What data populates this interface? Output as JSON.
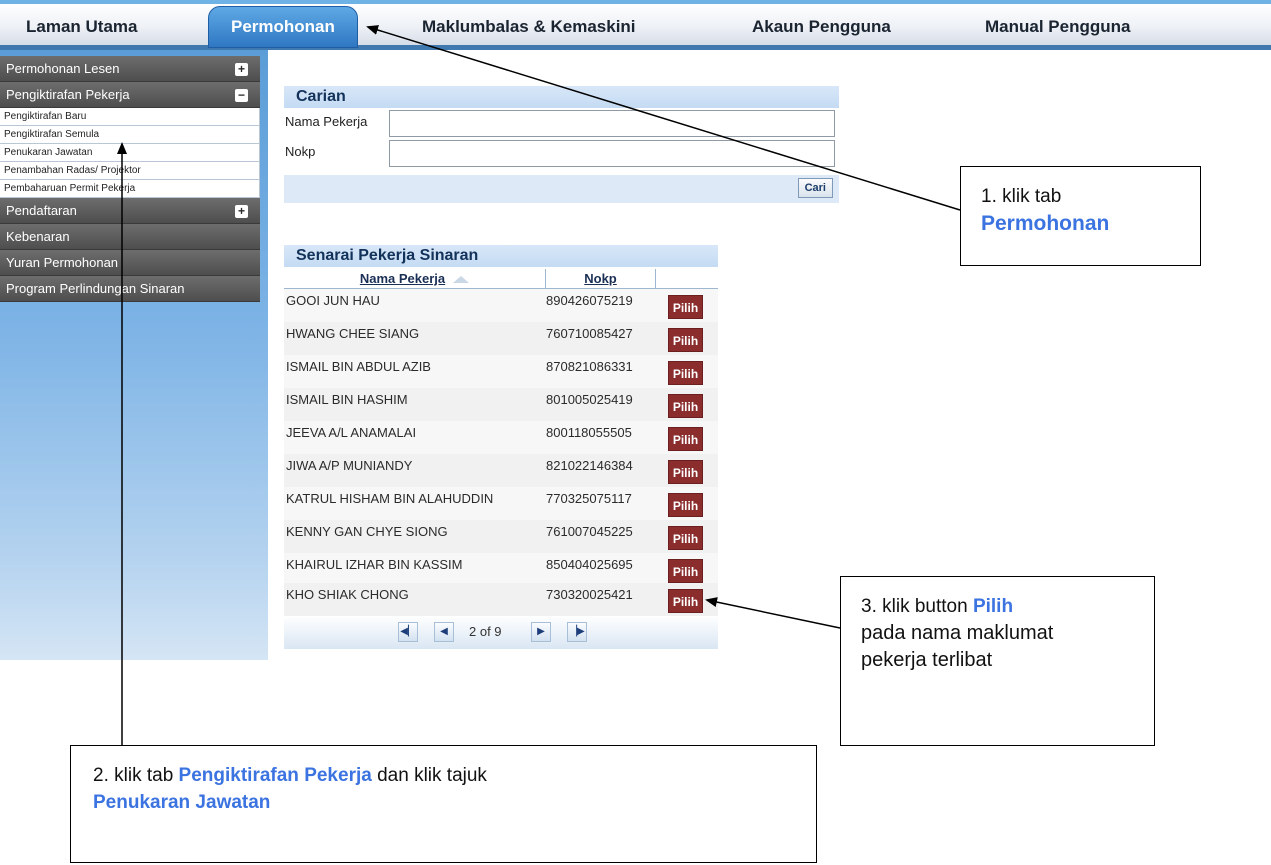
{
  "nav": {
    "tabs": [
      {
        "label": "Laman Utama"
      },
      {
        "label": "Permohonan"
      },
      {
        "label": "Maklumbalas & Kemaskini"
      },
      {
        "label": "Akaun Pengguna"
      },
      {
        "label": "Manual Pengguna"
      }
    ]
  },
  "sidebar": {
    "groups": [
      {
        "label": "Permohonan Lesen",
        "toggle": "+"
      },
      {
        "label": "Pengiktirafan Pekerja",
        "toggle": "−"
      },
      {
        "label": "Pendaftaran",
        "toggle": "+"
      },
      {
        "label": "Kebenaran"
      },
      {
        "label": "Yuran Permohonan"
      },
      {
        "label": "Program Perlindungan Sinaran"
      }
    ],
    "subitems": [
      {
        "label": "Pengiktirafan Baru"
      },
      {
        "label": "Pengiktirafan Semula"
      },
      {
        "label": "Penukaran Jawatan"
      },
      {
        "label": "Penambahan Radas/ Projektor"
      },
      {
        "label": "Pembaharuan Permit Pekerja"
      }
    ]
  },
  "search": {
    "title": "Carian",
    "name_label": "Nama Pekerja",
    "name_value": "",
    "nokp_label": "Nokp",
    "nokp_value": "",
    "button": "Cari"
  },
  "table": {
    "title": "Senarai Pekerja Sinaran",
    "headers": [
      "Nama Pekerja",
      "Nokp"
    ],
    "action_label": "Pilih",
    "rows": [
      {
        "name": "GOOI JUN HAU",
        "nokp": "890426075219"
      },
      {
        "name": "HWANG CHEE SIANG",
        "nokp": "760710085427"
      },
      {
        "name": "ISMAIL BIN ABDUL AZIB",
        "nokp": "870821086331"
      },
      {
        "name": "ISMAIL BIN HASHIM",
        "nokp": "801005025419"
      },
      {
        "name": "JEEVA A/L ANAMALAI",
        "nokp": "800118055505"
      },
      {
        "name": "JIWA A/P MUNIANDY",
        "nokp": "821022146384"
      },
      {
        "name": "KATRUL HISHAM BIN ALAHUDDIN",
        "nokp": "770325075117"
      },
      {
        "name": "KENNY GAN CHYE SIONG",
        "nokp": "761007045225"
      },
      {
        "name": "KHAIRUL IZHAR BIN KASSIM",
        "nokp": "850404025695"
      },
      {
        "name": "KHO SHIAK CHONG",
        "nokp": "730320025421"
      }
    ],
    "pager": {
      "text": "2 of 9"
    }
  },
  "callouts": {
    "c1": {
      "prefix": "1. klik tab",
      "highlight": "Permohonan"
    },
    "c2": {
      "prefix": "2. klik tab ",
      "highlight1": "Pengiktirafan Pekerja",
      "middle": " dan klik tajuk",
      "highlight2": "Penukaran Jawatan"
    },
    "c3": {
      "prefix": "3. klik button ",
      "highlight": "Pilih",
      "rest": "pada nama maklumat pekerja terlibat"
    }
  },
  "colors": {
    "accent": "#3b73e0",
    "tab_active": "#2f77c2",
    "pilih_button": "#8b2d2d"
  }
}
